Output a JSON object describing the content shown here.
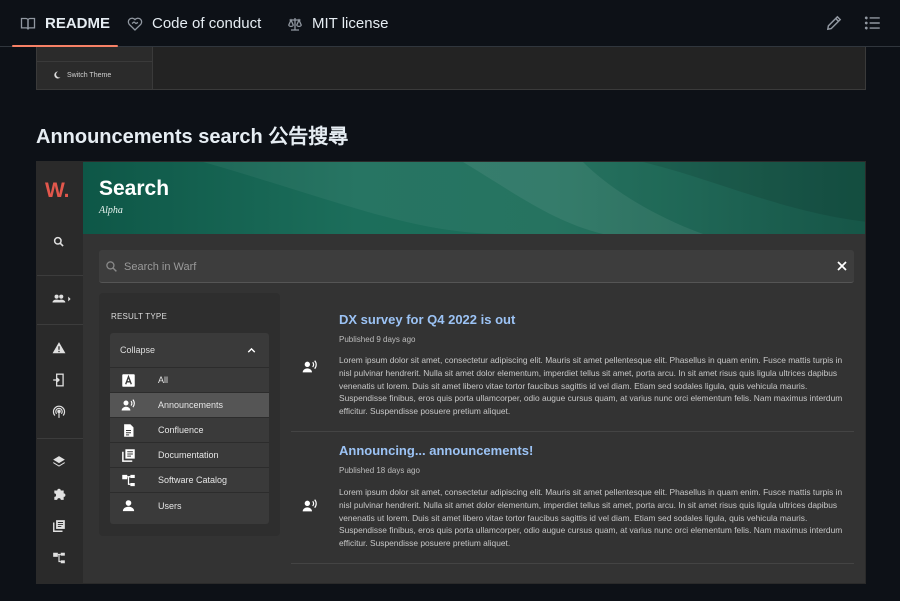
{
  "tabs": [
    {
      "label": "README",
      "icon": "book-icon",
      "active": true
    },
    {
      "label": "Code of conduct",
      "icon": "heart-handshake-icon",
      "active": false
    },
    {
      "label": "MIT license",
      "icon": "law-scale-icon",
      "active": false
    }
  ],
  "toolbar": {
    "edit_icon": "pencil-icon",
    "outline_icon": "list-icon"
  },
  "prev_screenshot": {
    "switch_theme": "Switch Theme"
  },
  "section": {
    "title": "Announcements search 公告搜尋"
  },
  "app": {
    "logo": "W.",
    "rail_icons": [
      "search-icon",
      "group-icon",
      "warning-icon",
      "exit-icon",
      "broadcast-icon",
      "layers-icon",
      "puzzle-icon",
      "library-icon",
      "catalog-icon"
    ],
    "banner": {
      "title": "Search",
      "subtitle": "Alpha"
    },
    "search": {
      "placeholder": "Search in Warf",
      "value": ""
    },
    "filter": {
      "title": "RESULT TYPE",
      "collapse_label": "Collapse",
      "items": [
        {
          "label": "All",
          "icon": "font-a-icon",
          "selected": false
        },
        {
          "label": "Announcements",
          "icon": "record-voice-icon",
          "selected": true
        },
        {
          "label": "Confluence",
          "icon": "document-icon",
          "selected": false
        },
        {
          "label": "Documentation",
          "icon": "library-books-icon",
          "selected": false
        },
        {
          "label": "Software Catalog",
          "icon": "catalog-tree-icon",
          "selected": false
        },
        {
          "label": "Users",
          "icon": "person-icon",
          "selected": false
        }
      ]
    },
    "results": [
      {
        "title": "DX survey for Q4 2022 is out",
        "date": "Published 9 days ago",
        "body": "Lorem ipsum dolor sit amet, consectetur adipiscing elit. Mauris sit amet pellentesque elit. Phasellus in quam enim. Fusce mattis turpis in nisl pulvinar hendrerit. Nulla sit amet dolor elementum, imperdiet tellus sit amet, porta arcu. In sit amet risus quis ligula ultrices dapibus venenatis ut lorem. Duis sit amet libero vitae tortor faucibus sagittis id vel diam. Etiam sed sodales ligula, quis vehicula mauris. Suspendisse finibus, eros quis porta ullamcorper, odio augue cursus quam, at varius nunc orci elementum felis. Nam maximus interdum efficitur. Suspendisse posuere pretium aliquet."
      },
      {
        "title": "Announcing... announcements!",
        "date": "Published 18 days ago",
        "body": "Lorem ipsum dolor sit amet, consectetur adipiscing elit. Mauris sit amet pellentesque elit. Phasellus in quam enim. Fusce mattis turpis in nisl pulvinar hendrerit. Nulla sit amet dolor elementum, imperdiet tellus sit amet, porta arcu. In sit amet risus quis ligula ultrices dapibus venenatis ut lorem. Duis sit amet libero vitae tortor faucibus sagittis id vel diam. Etiam sed sodales ligula, quis vehicula mauris. Suspendisse finibus, eros quis porta ullamcorper, odio augue cursus quam, at varius nunc orci elementum felis. Nam maximus interdum efficitur. Suspendisse posuere pretium aliquet."
      }
    ]
  },
  "colors": {
    "accent_tab": "#f78166",
    "banner": "#1c6e5b",
    "logo": "#e2574c",
    "link": "#9cc3f5"
  }
}
